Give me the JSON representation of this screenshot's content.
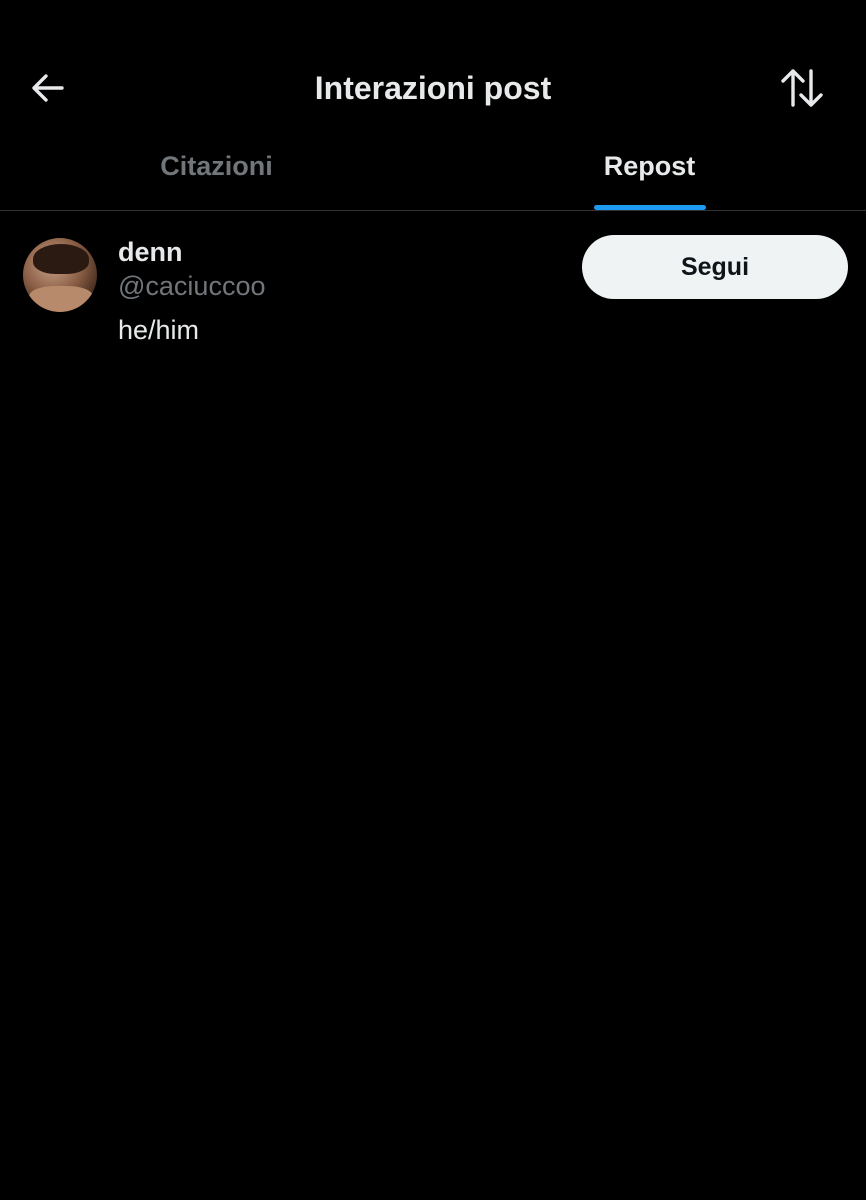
{
  "header": {
    "title": "Interazioni post",
    "back_icon": "arrow-left-icon",
    "sort_icon": "sort-arrows-icon"
  },
  "tabs": [
    {
      "label": "Citazioni",
      "active": false
    },
    {
      "label": "Repost",
      "active": true
    }
  ],
  "users": [
    {
      "display_name": "denn",
      "handle": "@caciuccoo",
      "bio": "he/him",
      "follow_label": "Segui"
    }
  ],
  "colors": {
    "background": "#000000",
    "accent": "#1d9bf0",
    "text_primary": "#e7e9ea",
    "text_secondary": "#71767b",
    "follow_button_bg": "#eff3f4"
  }
}
